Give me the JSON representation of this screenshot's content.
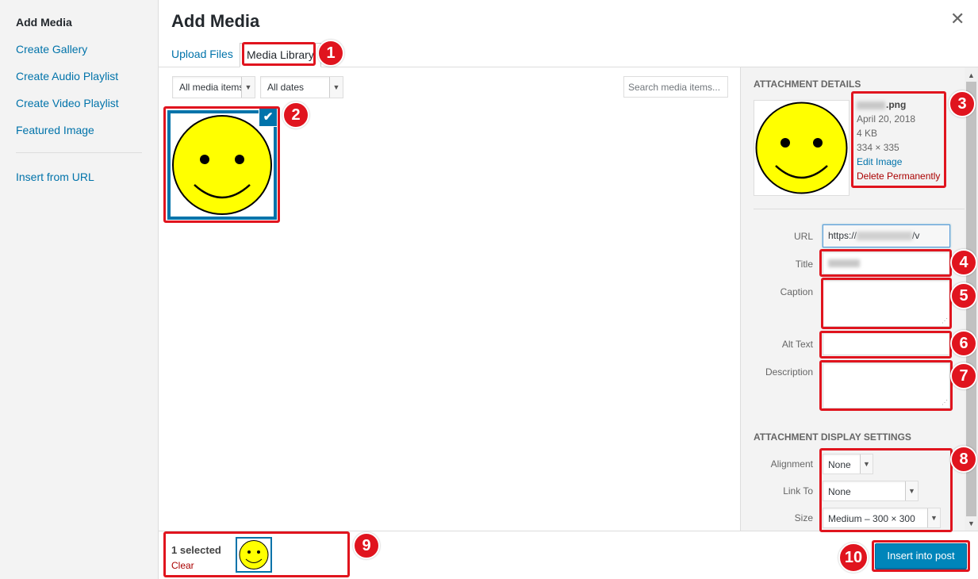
{
  "menu": {
    "items": [
      {
        "label": "Add Media"
      },
      {
        "label": "Create Gallery"
      },
      {
        "label": "Create Audio Playlist"
      },
      {
        "label": "Create Video Playlist"
      },
      {
        "label": "Featured Image"
      },
      {
        "label": "Insert from URL"
      }
    ]
  },
  "header": {
    "title": "Add Media",
    "close": "✕",
    "tabs": [
      {
        "label": "Upload Files"
      },
      {
        "label": "Media Library"
      }
    ]
  },
  "toolbar": {
    "media_filter": "All media items",
    "date_filter": "All dates",
    "search_placeholder": "Search media items..."
  },
  "sidebar": {
    "details_heading": "Attachment Details",
    "file": {
      "name_suffix": ".png",
      "date": "April 20, 2018",
      "size": "4 KB",
      "dimensions": "334 × 335",
      "edit": "Edit Image",
      "delete": "Delete Permanently"
    },
    "fields": {
      "url_label": "URL",
      "url_prefix": "https://",
      "url_suffix": "/v",
      "title_label": "Title",
      "caption_label": "Caption",
      "alt_label": "Alt Text",
      "description_label": "Description"
    },
    "display_heading": "Attachment Display Settings",
    "display": {
      "alignment_label": "Alignment",
      "alignment_value": "None",
      "link_label": "Link To",
      "link_value": "None",
      "size_label": "Size",
      "size_value": "Medium – 300 × 300"
    }
  },
  "footer": {
    "selected": "1 selected",
    "clear": "Clear",
    "insert": "Insert into post"
  },
  "annotations": [
    "1",
    "2",
    "3",
    "4",
    "5",
    "6",
    "7",
    "8",
    "9",
    "10"
  ],
  "colors": {
    "accent": "#0073aa",
    "annotation": "#e0141e",
    "smiley_fill": "#ffff00"
  }
}
